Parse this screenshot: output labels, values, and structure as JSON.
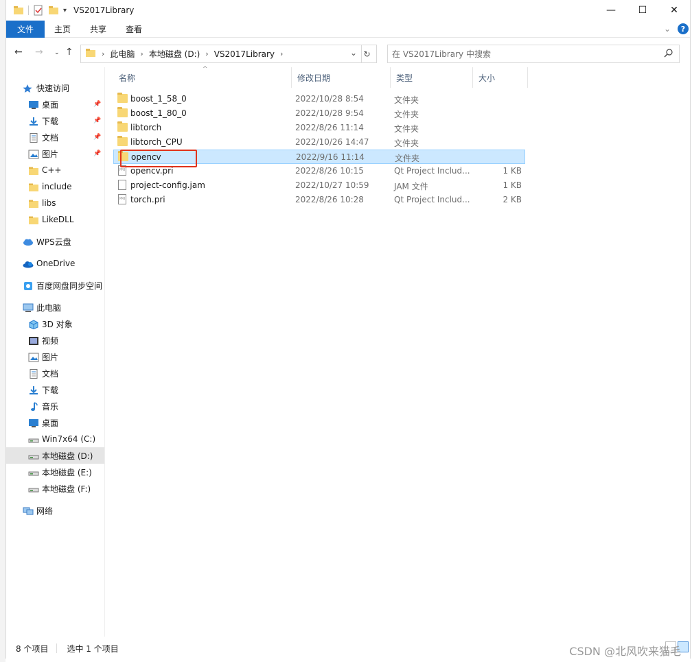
{
  "window": {
    "title": "VS2017Library",
    "controls": {
      "minimize": "—",
      "maximize": "☐",
      "close": "✕"
    }
  },
  "ribbon": {
    "tabs": [
      "文件",
      "主页",
      "共享",
      "查看"
    ],
    "expand": "⌄",
    "help": "?"
  },
  "address": {
    "segments": [
      "此电脑",
      "本地磁盘 (D:)",
      "VS2017Library"
    ],
    "dropdown": "⌄",
    "refresh": "↻"
  },
  "search": {
    "placeholder": "在 VS2017Library 中搜索"
  },
  "sidebar": {
    "items": [
      {
        "label": "快速访问",
        "icon": "star-icon",
        "level": 0
      },
      {
        "label": "桌面",
        "icon": "desktop-icon",
        "level": 1,
        "pinned": true
      },
      {
        "label": "下载",
        "icon": "download-icon",
        "level": 1,
        "pinned": true
      },
      {
        "label": "文档",
        "icon": "document-icon",
        "level": 1,
        "pinned": true
      },
      {
        "label": "图片",
        "icon": "picture-icon",
        "level": 1,
        "pinned": true
      },
      {
        "label": "C++",
        "icon": "folder-icon",
        "level": 1
      },
      {
        "label": "include",
        "icon": "folder-icon",
        "level": 1
      },
      {
        "label": "libs",
        "icon": "folder-icon",
        "level": 1
      },
      {
        "label": "LikeDLL",
        "icon": "folder-icon",
        "level": 1
      },
      {
        "label": "WPS云盘",
        "icon": "cloud-icon",
        "level": 0
      },
      {
        "label": "OneDrive",
        "icon": "onedrive-icon",
        "level": 0
      },
      {
        "label": "百度网盘同步空间",
        "icon": "baidu-icon",
        "level": 0
      },
      {
        "label": "此电脑",
        "icon": "computer-icon",
        "level": 0
      },
      {
        "label": "3D 对象",
        "icon": "cube-icon",
        "level": 1
      },
      {
        "label": "视频",
        "icon": "video-icon",
        "level": 1
      },
      {
        "label": "图片",
        "icon": "picture-icon",
        "level": 1
      },
      {
        "label": "文档",
        "icon": "document-icon",
        "level": 1
      },
      {
        "label": "下载",
        "icon": "download-icon",
        "level": 1
      },
      {
        "label": "音乐",
        "icon": "music-icon",
        "level": 1
      },
      {
        "label": "桌面",
        "icon": "desktop-icon",
        "level": 1
      },
      {
        "label": "Win7x64 (C:)",
        "icon": "drive-icon",
        "level": 1
      },
      {
        "label": "本地磁盘 (D:)",
        "icon": "drive-icon",
        "level": 1,
        "selected": true
      },
      {
        "label": "本地磁盘 (E:)",
        "icon": "drive-icon",
        "level": 1
      },
      {
        "label": "本地磁盘 (F:)",
        "icon": "drive-icon",
        "level": 1
      },
      {
        "label": "网络",
        "icon": "network-icon",
        "level": 0
      }
    ]
  },
  "list": {
    "columns": [
      "名称",
      "修改日期",
      "类型",
      "大小"
    ],
    "files": [
      {
        "name": "boost_1_58_0",
        "date": "2022/10/28 8:54",
        "type": "文件夹",
        "size": "",
        "kind": "folder"
      },
      {
        "name": "boost_1_80_0",
        "date": "2022/10/28 9:54",
        "type": "文件夹",
        "size": "",
        "kind": "folder"
      },
      {
        "name": "libtorch",
        "date": "2022/8/26 11:14",
        "type": "文件夹",
        "size": "",
        "kind": "folder"
      },
      {
        "name": "libtorch_CPU",
        "date": "2022/10/26 14:47",
        "type": "文件夹",
        "size": "",
        "kind": "folder"
      },
      {
        "name": "opencv",
        "date": "2022/9/16 11:14",
        "type": "文件夹",
        "size": "",
        "kind": "folder",
        "selected": true
      },
      {
        "name": "opencv.pri",
        "date": "2022/8/26 10:15",
        "type": "Qt Project Includ...",
        "size": "1 KB",
        "kind": "pri"
      },
      {
        "name": "project-config.jam",
        "date": "2022/10/27 10:59",
        "type": "JAM 文件",
        "size": "1 KB",
        "kind": "file"
      },
      {
        "name": "torch.pri",
        "date": "2022/8/26 10:28",
        "type": "Qt Project Includ...",
        "size": "2 KB",
        "kind": "pri"
      }
    ]
  },
  "status": {
    "count": "8 个项目",
    "selected": "选中 1 个项目"
  },
  "watermark": "CSDN @北风吹来猫毛",
  "colors": {
    "accent": "#1a6fc9",
    "selection": "#cce8ff",
    "highlight": "#e0321c",
    "folder": "#f8d775"
  }
}
